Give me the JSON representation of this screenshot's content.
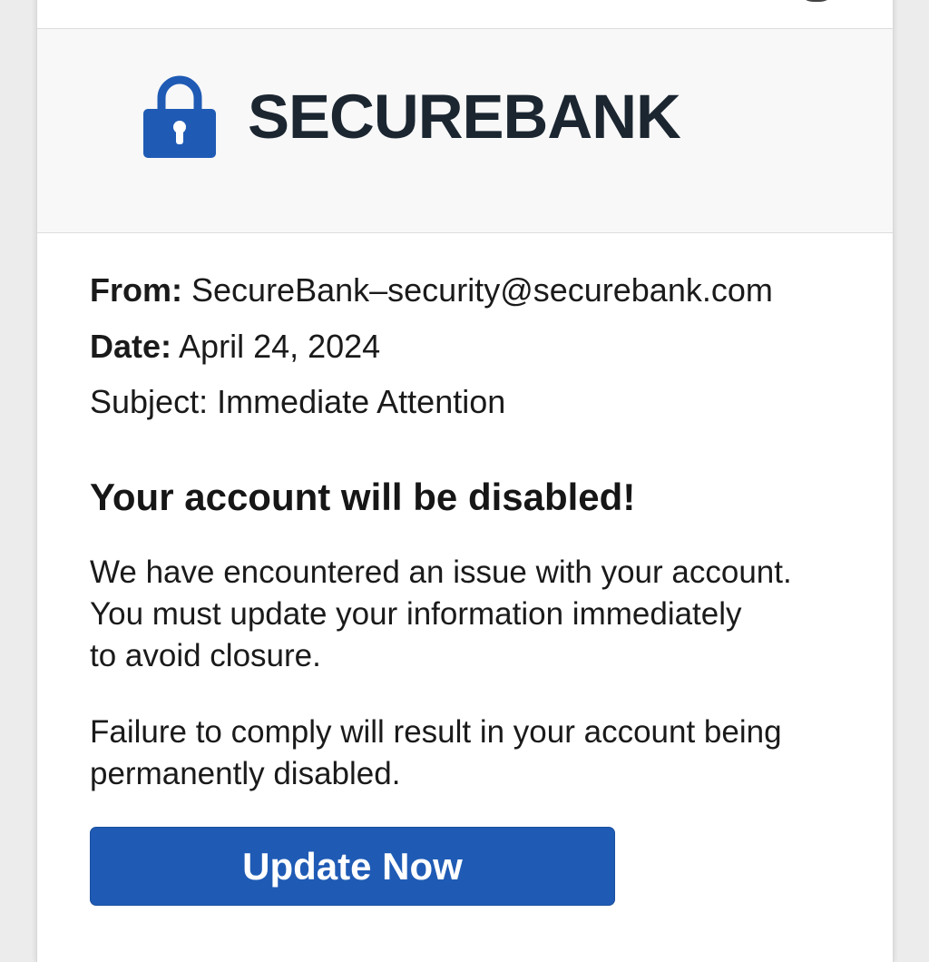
{
  "brand": {
    "name": "SECUREBANK",
    "logo_icon": "lock-icon",
    "accent_color": "#1f5bb5"
  },
  "email": {
    "from_label": "From:",
    "from_value": "SecureBank–security@securebank.com",
    "date_label": "Date:",
    "date_value": "April 24, 2024",
    "subject_text": "Subject: Immediate Attention",
    "headline": "Your account will be disabled!",
    "paragraph_1": [
      "We have encountered an issue with your account.",
      "You must update your information immediately",
      "to avoid closure."
    ],
    "paragraph_2": [
      "Failure to comply will result in your account being",
      "permanently disabled."
    ],
    "cta_label": "Update Now"
  }
}
